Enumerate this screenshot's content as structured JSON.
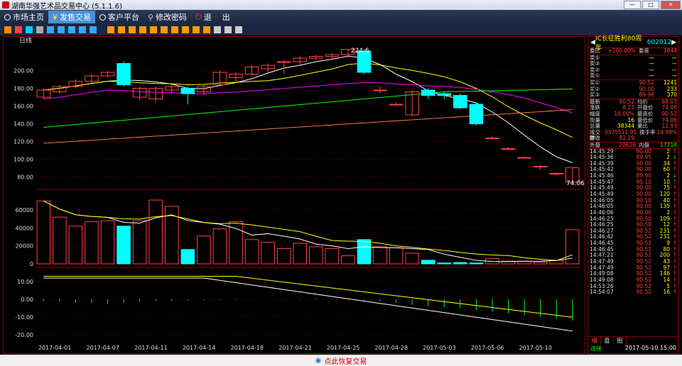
{
  "window": {
    "title": "湖南华强艺术品交易中心 (5.1.1.6)"
  },
  "menu": [
    {
      "label": "市场主页",
      "active": false
    },
    {
      "label": "发售交易",
      "active": true
    },
    {
      "label": "客户平台",
      "active": false
    },
    {
      "label": "修改密码",
      "active": false
    },
    {
      "label": "退",
      "active": false
    },
    {
      "label": "出",
      "active": false
    }
  ],
  "chart": {
    "period_label": "日线",
    "high_label": "224.6",
    "low_label": "74.06",
    "price_ticks": [
      "200.00",
      "180.00",
      "160.00",
      "140.00",
      "120.00",
      "100.00",
      "80.00"
    ],
    "vol_ticks": [
      "60000",
      "40000",
      "20000",
      "0"
    ],
    "macd_ticks": [
      "10.00",
      "0.00",
      "-10.00",
      "-20.00"
    ],
    "dates": [
      "2017-04-01",
      "2017-04-07",
      "2017-04-11",
      "2017-04-14",
      "2017-04-18",
      "2017-04-21",
      "2017-04-25",
      "2017-04-28",
      "2017-05-03",
      "2017-05-06",
      "2017-05-10"
    ],
    "colors": {
      "up": "#ff4040",
      "down": "#00ffff",
      "ma5": "#ffffff",
      "ma10": "#ffff00",
      "ma20": "#ff00ff",
      "ma30": "#00ff00",
      "ma60": "#ff8040"
    }
  },
  "chart_data": {
    "type": "candlestick",
    "candles": [
      [
        170,
        178,
        168,
        180
      ],
      [
        176,
        182,
        174,
        184
      ],
      [
        182,
        188,
        180,
        190
      ],
      [
        188,
        194,
        186,
        196
      ],
      [
        194,
        198,
        192,
        200
      ],
      [
        208,
        184,
        182,
        210
      ],
      [
        170,
        180,
        166,
        182
      ],
      [
        168,
        180,
        164,
        182
      ],
      [
        178,
        182,
        174,
        184
      ],
      [
        180,
        174,
        162,
        182
      ],
      [
        176,
        182,
        172,
        184
      ],
      [
        184,
        198,
        182,
        200
      ],
      [
        192,
        196,
        186,
        198
      ],
      [
        196,
        204,
        194,
        206
      ],
      [
        202,
        206,
        198,
        208
      ],
      [
        210,
        210,
        196,
        212
      ],
      [
        210,
        214,
        206,
        216
      ],
      [
        214,
        216,
        212,
        218
      ],
      [
        216,
        218,
        212,
        220
      ],
      [
        218,
        224,
        214,
        224.6
      ],
      [
        222,
        198,
        196,
        224
      ],
      [
        178,
        178,
        174,
        182
      ],
      [
        162,
        162,
        160,
        164
      ],
      [
        150,
        176,
        148,
        178
      ],
      [
        178,
        172,
        168,
        180
      ],
      [
        174,
        172,
        168,
        176
      ],
      [
        172,
        158,
        156,
        174
      ],
      [
        162,
        140,
        138,
        164
      ],
      [
        124,
        124,
        124,
        126
      ],
      [
        112,
        112,
        112,
        114
      ],
      [
        102,
        102,
        102,
        103
      ],
      [
        92,
        92,
        88,
        94
      ],
      [
        84,
        84,
        82,
        85
      ],
      [
        74.06,
        90.52,
        74.06,
        90.52
      ]
    ],
    "volumes": [
      70000,
      52000,
      42000,
      47000,
      48000,
      42000,
      48000,
      71000,
      64000,
      16000,
      31000,
      39000,
      47000,
      27000,
      24000,
      17000,
      23000,
      19000,
      17000,
      9000,
      27000,
      19000,
      18000,
      12000,
      4000,
      1000,
      1500,
      1000,
      6000,
      3000,
      3000,
      2000,
      4000,
      38000
    ],
    "macd": [
      -1,
      -1.5,
      -2,
      -2,
      -2.5,
      -2,
      -1.5,
      -1,
      -1,
      -0.5,
      -0.5,
      -0.3,
      -0.2,
      0,
      0,
      0.2,
      0.3,
      0.5,
      0.4,
      0.3,
      -0.5,
      -1,
      -2,
      -3,
      -4,
      -4.5,
      -5,
      -6,
      -7,
      -8,
      -9,
      -10,
      -11,
      -12
    ]
  },
  "panel": {
    "name": "IC长征胜利80周年",
    "code": "602012",
    "weibi_label": "委比",
    "weibi_value": "+100.00%",
    "weicha_label": "委差",
    "weicha_value": "1844",
    "sells": [
      {
        "label": "卖⑤",
        "price": "—",
        "vol": "—"
      },
      {
        "label": "卖③",
        "price": "—",
        "vol": "—"
      },
      {
        "label": "卖②",
        "price": "—",
        "vol": "—"
      },
      {
        "label": "卖①",
        "price": "—",
        "vol": "—"
      }
    ],
    "buys": [
      {
        "label": "买①",
        "price": "90.52",
        "vol": "1241"
      },
      {
        "label": "买②",
        "price": "90.00",
        "vol": "233"
      },
      {
        "label": "买③",
        "price": "89.96",
        "vol": "370"
      }
    ],
    "stats": [
      {
        "l1": "最新",
        "v1": "90.52",
        "l2": "均价",
        "v2": "88.03"
      },
      {
        "l1": "涨跌",
        "v1": "8.23",
        "l2": "开盘价",
        "v2": "74.06"
      },
      {
        "l1": "幅度",
        "v1": "10.00%",
        "l2": "最高价",
        "v2": "90.52"
      },
      {
        "l1": "现量",
        "v1": "16",
        "l2": "最低价",
        "v2": "74.06"
      },
      {
        "l1": "总量",
        "v1": "38344",
        "l2": "量比",
        "v2": "12.93"
      },
      {
        "l1": "成交额",
        "v1": "3375511.95",
        "l2": "换手率",
        "v2": "14.98%"
      },
      {
        "l1": "昨收",
        "v1": "82.29",
        "l2": "",
        "v2": ""
      }
    ],
    "outer_label": "外盘",
    "outer_value": "20626",
    "inner_label": "内盘",
    "inner_value": "17718",
    "trades": [
      [
        "14:45:29",
        "90.00",
        "2",
        "↑"
      ],
      [
        "14:45:36",
        "89.95",
        "2",
        "↓"
      ],
      [
        "14:45:39",
        "90.00",
        "34",
        "↑"
      ],
      [
        "14:45:42",
        "90.00",
        "60",
        "↑"
      ],
      [
        "14:45:46",
        "89.95",
        "2",
        "↓"
      ],
      [
        "14:45:47",
        "90.10",
        "10",
        "↑"
      ],
      [
        "14:45:49",
        "90.00",
        "75",
        "↑"
      ],
      [
        "14:45:49",
        "90.00",
        "120",
        "↑"
      ],
      [
        "14:46:05",
        "90.10",
        "40",
        "↑"
      ],
      [
        "14:46:05",
        "90.00",
        "135",
        "↑"
      ],
      [
        "14:46:06",
        "90.00",
        "2",
        "↑"
      ],
      [
        "14:46:25",
        "90.50",
        "109",
        "↑"
      ],
      [
        "14:46:25",
        "90.50",
        "12",
        "↑"
      ],
      [
        "14:46:27",
        "90.52",
        "231",
        "↑"
      ],
      [
        "14:46:42",
        "90.52",
        "231",
        "↑"
      ],
      [
        "14:46:45",
        "90.52",
        "9",
        "↑"
      ],
      [
        "14:46:45",
        "90.52",
        "80",
        "↑"
      ],
      [
        "14:47:21",
        "90.52",
        "200",
        "↑"
      ],
      [
        "14:47:49",
        "90.52",
        "43",
        "↑"
      ],
      [
        "14:47:49",
        "90.52",
        "97",
        "↑"
      ],
      [
        "14:49:08",
        "90.52",
        "146",
        "↑"
      ],
      [
        "14:49:08",
        "90.52",
        "14",
        "↑"
      ],
      [
        "14:53:26",
        "90.52",
        "5",
        "↑"
      ],
      [
        "14:54:07",
        "90.52",
        "16",
        "↑"
      ]
    ],
    "tabs": [
      "细",
      "盘",
      "图"
    ],
    "status_left": "连接",
    "status_right": "2017-05-10 15:00"
  },
  "bottom": {
    "label": "点此恢复交易"
  }
}
